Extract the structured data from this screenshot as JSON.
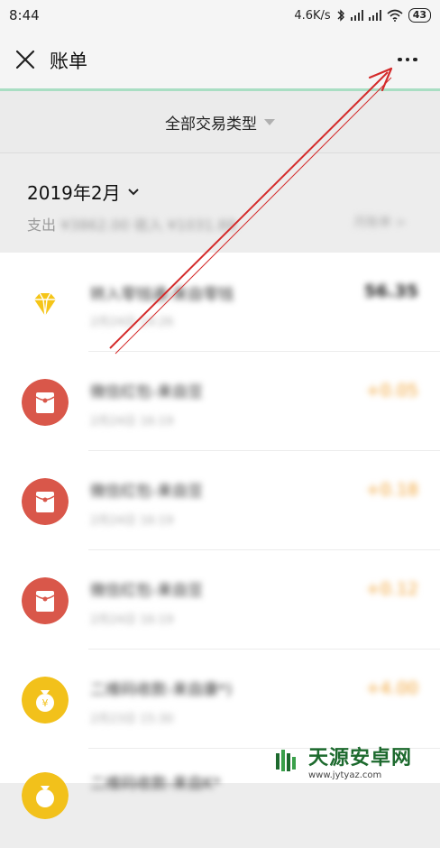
{
  "status_bar": {
    "time": "8:44",
    "network_speed": "4.6K/s",
    "battery": "43",
    "icons": [
      "bluetooth-icon",
      "signal-icon",
      "signal-icon",
      "wifi-icon",
      "battery-icon"
    ]
  },
  "nav": {
    "title": "账单",
    "close_icon": "close-icon",
    "more_icon": "more-icon"
  },
  "filter": {
    "label": "全部交易类型"
  },
  "month": {
    "label": "2019年2月",
    "stats_prefix": "支出",
    "stats_blurred": "¥3862.00 收入 ¥1031.88",
    "link": "月账单 >"
  },
  "transactions": [
    {
      "title": "转入零钱通-来自零钱",
      "time": "2月24日 14:26",
      "amount": "56.35",
      "icon": "diamond-icon",
      "type": "neg"
    },
    {
      "title": "微信红包-来自豆",
      "time": "2月24日 16:19",
      "amount": "+0.05",
      "icon": "red-packet-icon",
      "type": "pos"
    },
    {
      "title": "微信红包-来自豆",
      "time": "2月24日 16:19",
      "amount": "+0.18",
      "icon": "red-packet-icon",
      "type": "pos"
    },
    {
      "title": "微信红包-来自豆",
      "time": "2月24日 16:19",
      "amount": "+0.12",
      "icon": "red-packet-icon",
      "type": "pos"
    },
    {
      "title": "二维码收款-来自康*)",
      "time": "2月23日 15:30",
      "amount": "+4.00",
      "icon": "money-bag-icon",
      "type": "pos"
    },
    {
      "title": "二维码收款-来自K*",
      "time": "",
      "amount": "",
      "icon": "money-bag-icon",
      "type": "pos"
    }
  ],
  "watermark": {
    "cn": "天源安卓网",
    "en": "www.jytyaz.com"
  },
  "colors": {
    "accent_green": "#a9dec3",
    "red_packet": "#d9574a",
    "money_bag": "#f2c11b",
    "diamond": "#f5c518",
    "income_amount": "#f0a030",
    "annotation_arrow": "#d42a2a"
  }
}
